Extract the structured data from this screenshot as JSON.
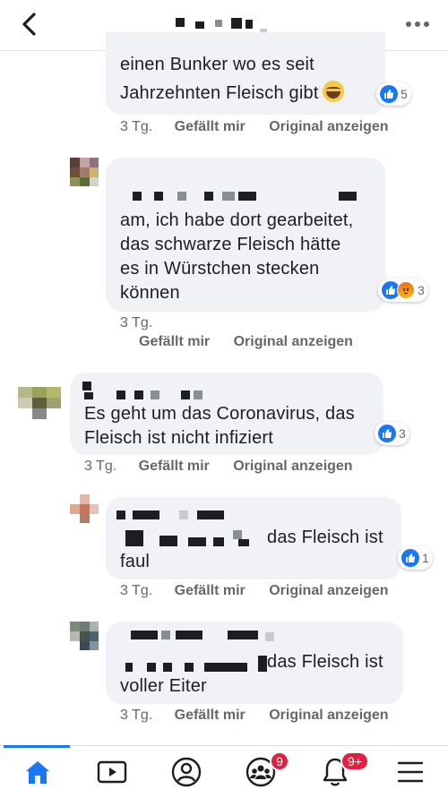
{
  "header": {
    "back_icon": "chevron-left-icon",
    "more_icon": "more-horizontal-icon"
  },
  "comments": [
    {
      "text_lines": [
        "einen Bunker wo es seit",
        "Jahrzehnten Fleisch gibt"
      ],
      "emoji": "laughing-face-emoji",
      "reaction_count": "5",
      "reactions": [
        "like"
      ],
      "time": "3 Tg.",
      "like_label": "Gefällt mir",
      "translate_label": "Original anzeigen"
    },
    {
      "text_lines": [
        "am, ich habe dort gearbeitet,",
        "das schwarze Fleisch hätte",
        "es in Würstchen stecken",
        "können"
      ],
      "reaction_count": "3",
      "reactions": [
        "like",
        "angry"
      ],
      "time": "3 Tg.",
      "like_label": "Gefällt mir",
      "translate_label": "Original anzeigen"
    },
    {
      "text_lines": [
        "Es geht um das Coronavirus, das",
        "Fleisch ist nicht infiziert"
      ],
      "reaction_count": "3",
      "reactions": [
        "like"
      ],
      "time": "3 Tg.",
      "like_label": "Gefällt mir",
      "translate_label": "Original anzeigen"
    },
    {
      "text_lines": [
        "das Fleisch ist",
        "faul"
      ],
      "reaction_count": "1",
      "reactions": [
        "like"
      ],
      "time": "3 Tg.",
      "like_label": "Gefällt mir",
      "translate_label": "Original anzeigen"
    },
    {
      "text_lines": [
        "das Fleisch ist",
        "voller Eiter"
      ],
      "time": "3 Tg.",
      "like_label": "Gefällt mir",
      "translate_label": "Original anzeigen"
    }
  ],
  "bottom_nav": {
    "tabs": [
      {
        "icon": "home-icon",
        "active": true
      },
      {
        "icon": "video-icon"
      },
      {
        "icon": "profile-icon"
      },
      {
        "icon": "groups-icon",
        "badge": "9"
      },
      {
        "icon": "notifications-bell-icon",
        "badge": "9+"
      },
      {
        "icon": "menu-icon"
      }
    ]
  },
  "colors": {
    "accent": "#1877f2",
    "bubble": "#f0f2f5",
    "badge": "#e41e3f",
    "meta_text": "#65676b"
  }
}
